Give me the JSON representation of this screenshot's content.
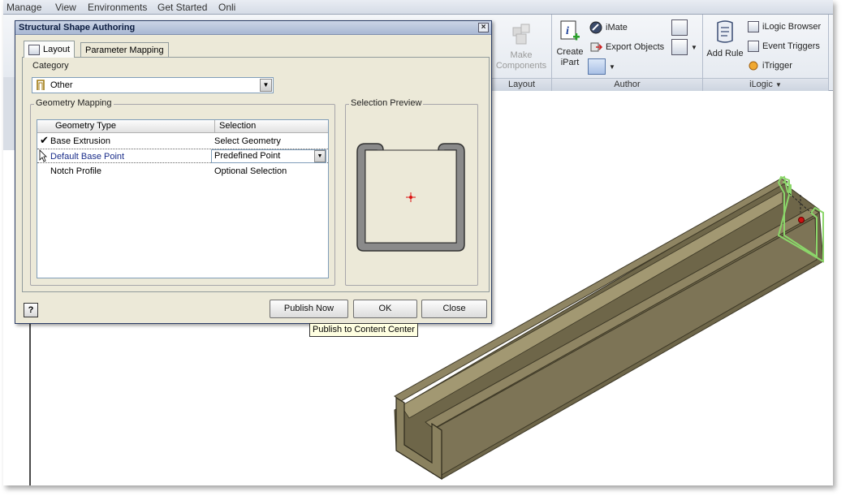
{
  "menu": {
    "tabs": [
      "Manage",
      "View",
      "Environments",
      "Get Started",
      "Onli"
    ]
  },
  "ribbon": {
    "make_components": "Make\nComponents",
    "layout_footer": "Layout",
    "create_ipart": "Create\niPart",
    "imate": "iMate",
    "export_objects": "Export Objects",
    "author_footer": "Author",
    "add_rule": "Add Rule",
    "ilogic_browser": "iLogic Browser",
    "event_triggers": "Event Triggers",
    "itrigger": "iTrigger",
    "ilogic_footer": "iLogic",
    "ilogic_dropdown": "▼"
  },
  "dialog": {
    "title": "Structural Shape Authoring",
    "close": "×",
    "tabs": {
      "layout": "Layout",
      "parameter_mapping": "Parameter Mapping"
    },
    "category_label": "Category",
    "category_value": "Other",
    "geometry_mapping_title": "Geometry Mapping",
    "selection_preview_title": "Selection Preview",
    "grid": {
      "headers": {
        "geometry_type": "Geometry Type",
        "selection": "Selection"
      },
      "rows": [
        {
          "check": "✔",
          "type": "Base Extrusion",
          "selection": "Select Geometry"
        },
        {
          "check": "",
          "type": "Default Base Point",
          "selection": "Predefined Point"
        },
        {
          "check": "",
          "type": "Notch Profile",
          "selection": "Optional Selection"
        }
      ]
    },
    "help": "?",
    "buttons": {
      "publish_now": "Publish Now",
      "ok": "OK",
      "close": "Close"
    }
  },
  "tooltip": "Publish to Content Center",
  "colors": {
    "channel_fill": "#7d7456",
    "channel_dark": "#5a5238",
    "highlight": "#8bd66a",
    "point": "#cc1111"
  }
}
